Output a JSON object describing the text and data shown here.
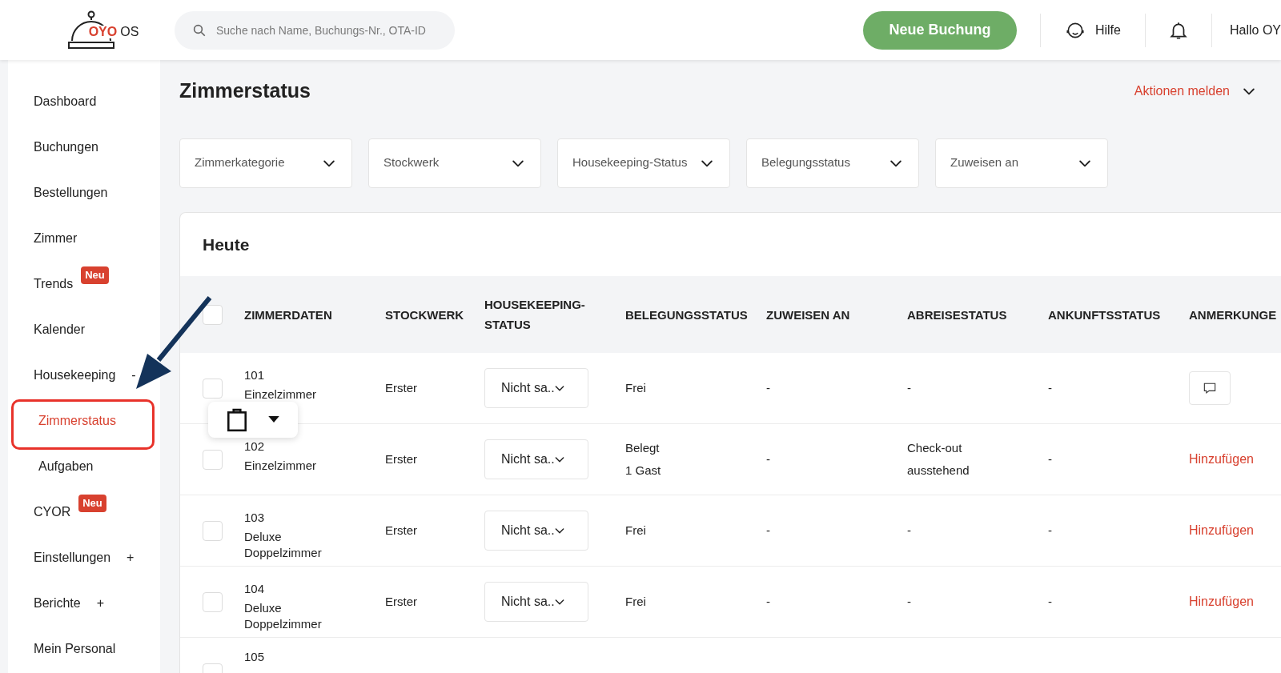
{
  "logo": {
    "brand": "OYO",
    "suffix": "OS"
  },
  "search": {
    "placeholder": "Suche nach Name, Buchungs-Nr., OTA-ID"
  },
  "header": {
    "new_booking": "Neue Buchung",
    "help": "Hilfe",
    "greeting": "Hallo OY"
  },
  "sidebar": {
    "items": [
      {
        "label": "Dashboard",
        "selected": false
      },
      {
        "label": "Buchungen",
        "selected": false
      },
      {
        "label": "Bestellungen",
        "selected": false
      },
      {
        "label": "Zimmer",
        "selected": false
      },
      {
        "label": "Trends",
        "selected": false,
        "badge": "Neu"
      },
      {
        "label": "Kalender",
        "selected": false
      },
      {
        "label": "Housekeeping",
        "selected": false,
        "toggle": "-",
        "children": [
          {
            "label": "Zimmerstatus",
            "selected": true
          },
          {
            "label": "Aufgaben",
            "selected": false
          }
        ]
      },
      {
        "label": "CYOR",
        "selected": false,
        "badge": "Neu"
      },
      {
        "label": "Einstellungen",
        "selected": false,
        "toggle": "+"
      },
      {
        "label": "Berichte",
        "selected": false,
        "toggle": "+"
      },
      {
        "label": "Mein Personal",
        "selected": false
      }
    ]
  },
  "page": {
    "title": "Zimmerstatus",
    "actions": "Aktionen melden"
  },
  "filters": [
    "Zimmerkategorie",
    "Stockwerk",
    "Housekeeping-Status",
    "Belegungsstatus",
    "Zuweisen an"
  ],
  "table": {
    "title": "Heute",
    "header_checked": false,
    "columns": [
      "ZIMMERDATEN",
      "STOCKWERK",
      "HOUSEKEEPING-STATUS",
      "BELEGUNGSSTATUS",
      "ZUWEISEN AN",
      "ABREISESTATUS",
      "ANKUNFTSSTATUS",
      "ANMERKUNGE"
    ],
    "rows": [
      {
        "checked": false,
        "number": "101",
        "type": "Einzelzimmer",
        "floor": "Erster",
        "housekeeping": "Nicht sa..",
        "occupancy": [
          "Frei"
        ],
        "assign": "-",
        "departure": [
          "-"
        ],
        "arrival": "-",
        "notes": {
          "kind": "icon"
        }
      },
      {
        "checked": false,
        "number": "102",
        "type": "Einzelzimmer",
        "floor": "Erster",
        "housekeeping": "Nicht sa..",
        "occupancy": [
          "Belegt",
          "1 Gast"
        ],
        "assign": "-",
        "departure": [
          "Check-out",
          "ausstehend"
        ],
        "arrival": "-",
        "notes": {
          "kind": "link",
          "label": "Hinzufügen"
        }
      },
      {
        "checked": false,
        "number": "103",
        "type": "Deluxe Doppelzimmer",
        "floor": "Erster",
        "housekeeping": "Nicht sa..",
        "occupancy": [
          "Frei"
        ],
        "assign": "-",
        "departure": [
          "-"
        ],
        "arrival": "-",
        "notes": {
          "kind": "link",
          "label": "Hinzufügen"
        }
      },
      {
        "checked": false,
        "number": "104",
        "type": "Deluxe Doppelzimmer",
        "floor": "Erster",
        "housekeeping": "Nicht sa..",
        "occupancy": [
          "Frei"
        ],
        "assign": "-",
        "departure": [
          "-"
        ],
        "arrival": "-",
        "notes": {
          "kind": "link",
          "label": "Hinzufügen"
        }
      },
      {
        "checked": false,
        "number": "105"
      }
    ]
  }
}
